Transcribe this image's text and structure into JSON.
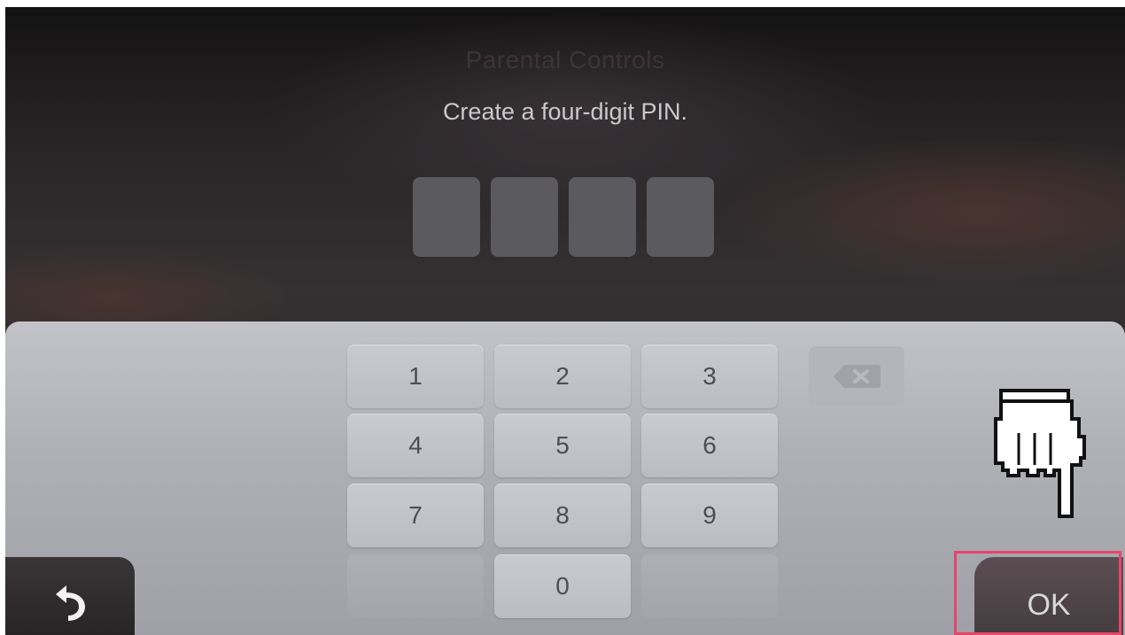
{
  "screen": {
    "title": "Parental Controls",
    "prompt": "Create a four-digit PIN."
  },
  "pin": {
    "digit_count": 4,
    "entered": [
      "",
      "",
      "",
      ""
    ]
  },
  "keypad": {
    "keys": {
      "k1": "1",
      "k2": "2",
      "k3": "3",
      "k4": "4",
      "k5": "5",
      "k6": "6",
      "k7": "7",
      "k8": "8",
      "k9": "9",
      "k0": "0"
    },
    "backspace_icon": "backspace-icon"
  },
  "controls": {
    "back_icon": "back-arrow-icon",
    "ok_label": "OK"
  },
  "overlay": {
    "cursor_icon": "hand-pointer-icon",
    "highlight_color": "#e8456a"
  }
}
